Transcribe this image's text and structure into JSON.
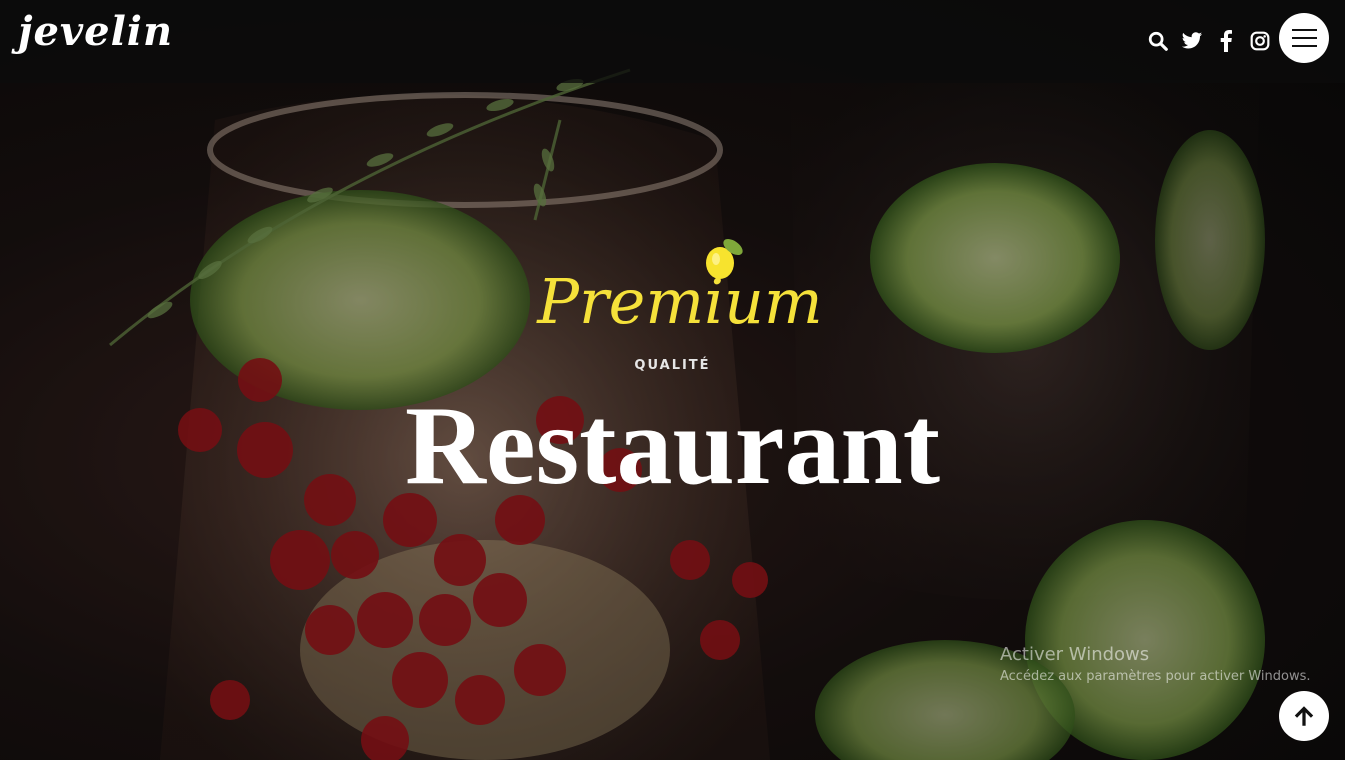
{
  "header": {
    "logo": "jevelin",
    "social": [
      "search-icon",
      "twitter-icon",
      "facebook-icon",
      "instagram-icon"
    ]
  },
  "hero": {
    "script": "Premium",
    "tagline": "QUALITÉ",
    "headline": "Restaurant"
  },
  "watermark": {
    "title": "Activer Windows",
    "subtitle": "Accédez aux paramètres pour activer Windows."
  },
  "colors": {
    "accent_yellow": "#f5e13a",
    "header_bg": "#0c0c0c"
  }
}
